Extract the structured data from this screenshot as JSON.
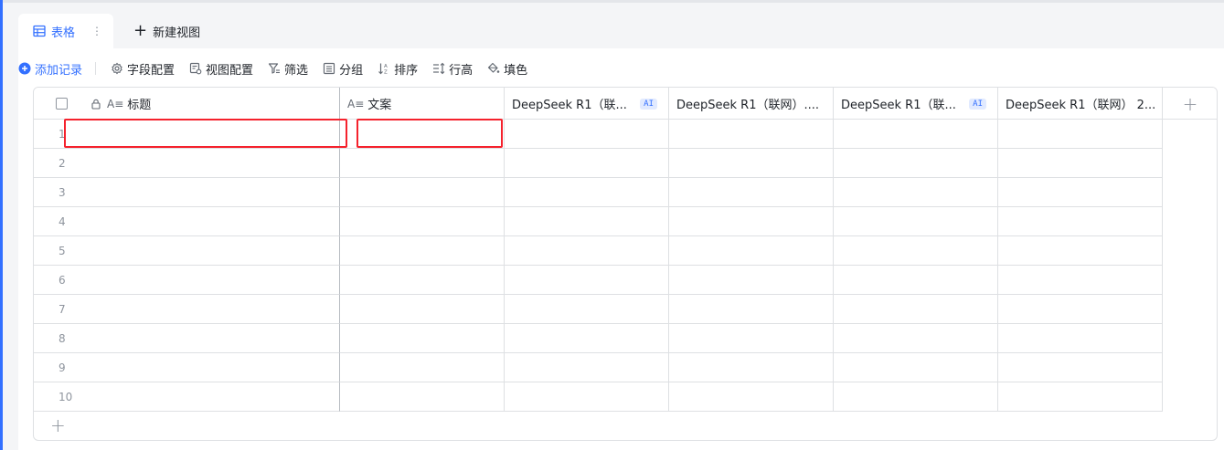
{
  "tabs": [
    {
      "label": "表格",
      "active": true,
      "more": "⋮"
    },
    {
      "label": "新建视图",
      "prefix": "+"
    }
  ],
  "toolbar": {
    "add_record": "添加记录",
    "field_config": "字段配置",
    "view_config": "视图配置",
    "filter": "筛选",
    "group": "分组",
    "sort": "排序",
    "row_height": "行高",
    "fill_color": "填色"
  },
  "columns": [
    {
      "label": "标题",
      "prefix": "A≡"
    },
    {
      "label": "文案",
      "prefix": "A≡"
    },
    {
      "label": "DeepSeek R1（联...",
      "badge": "AI"
    },
    {
      "label": "DeepSeek R1（联网）...."
    },
    {
      "label": "DeepSeek R1（联...",
      "badge": "AI"
    },
    {
      "label": "DeepSeek R1（联网） 2..."
    }
  ],
  "add_column": "+",
  "rows": [
    "1",
    "2",
    "3",
    "4",
    "5",
    "6",
    "7",
    "8",
    "9",
    "10"
  ],
  "add_row": "+",
  "colors": {
    "accent": "#3370ff",
    "highlight": "#f5222d"
  }
}
